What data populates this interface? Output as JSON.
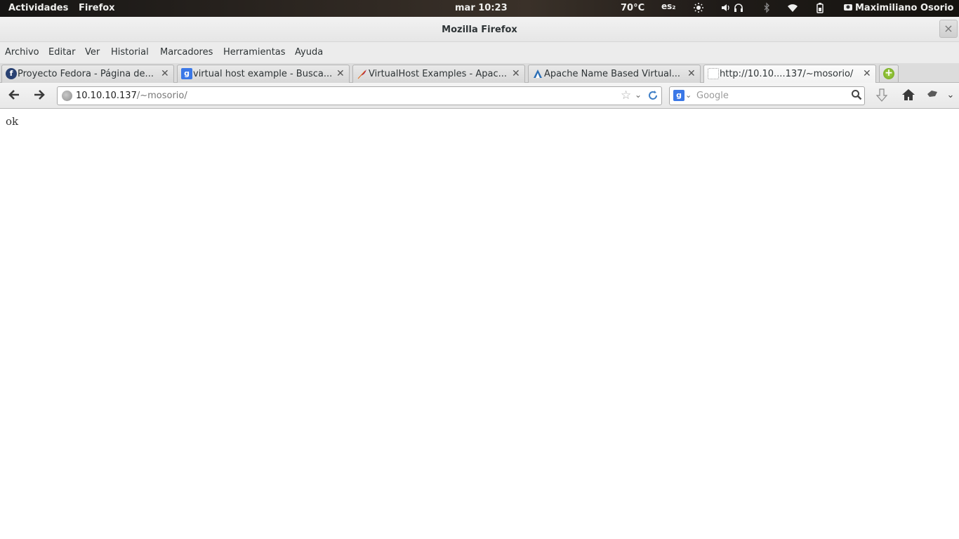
{
  "topbar": {
    "activities": "Actividades",
    "app": "Firefox",
    "clock": "mar 10:23",
    "temperature": "70°C",
    "keyboard": "es₂",
    "user": "Maximiliano Osorio"
  },
  "window": {
    "title": "Mozilla Firefox",
    "close_glyph": "×"
  },
  "menubar": {
    "items": [
      "Archivo",
      "Editar",
      "Ver",
      "Historial",
      "Marcadores",
      "Herramientas",
      "Ayuda"
    ]
  },
  "tabs": [
    {
      "label": "Proyecto Fedora - Página de...",
      "icon": "fedora-icon",
      "color": "#294172",
      "active": false
    },
    {
      "label": "virtual host example - Busca...",
      "icon": "google-icon",
      "color": "#3b78e7",
      "active": false
    },
    {
      "label": "VirtualHost Examples - Apac...",
      "icon": "apache-feather-icon",
      "color": "#a0144e",
      "active": false
    },
    {
      "label": "Apache Name Based Virtual...",
      "icon": "site-icon",
      "color": "#2b6fb6",
      "active": false
    },
    {
      "label": "http://10.10....137/~mosorio/",
      "icon": "blank-page-icon",
      "color": "#ffffff",
      "active": true
    }
  ],
  "navbar": {
    "url_host": "10.10.10.137",
    "url_path": "/~mosorio/",
    "search_placeholder": "Google"
  },
  "content": {
    "text": "ok"
  }
}
